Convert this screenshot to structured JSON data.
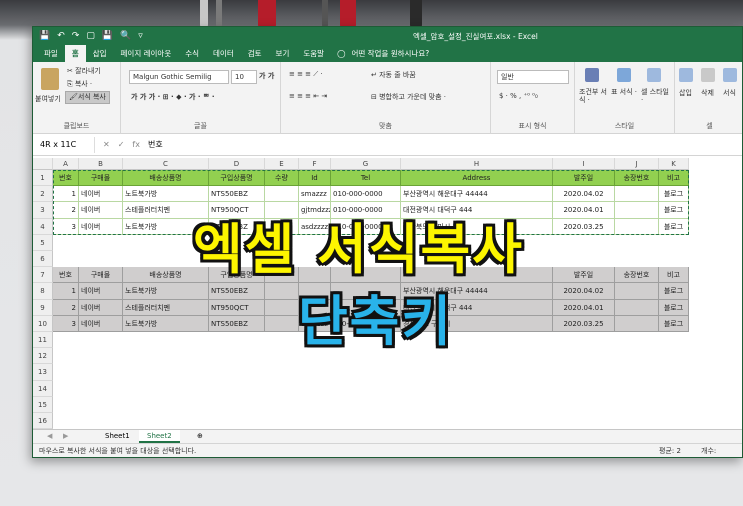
{
  "window": {
    "title": "엑셀_암호_설정_진실여포.xlsx  -  Excel",
    "quick_access": [
      "💾",
      "↶",
      "↷",
      "▢",
      "💾",
      "🔍",
      "▿"
    ]
  },
  "tabs": [
    "파일",
    "홈",
    "삽입",
    "페이지 레이아웃",
    "수식",
    "데이터",
    "검토",
    "보기",
    "도움말"
  ],
  "tell_me": "어떤 작업을 원하시나요?",
  "ribbon": {
    "clipboard": {
      "paste": "붙여넣기",
      "cut": "잘라내기",
      "copy": "복사 ·",
      "format_painter": "서식 복사",
      "label": "클립보드"
    },
    "font": {
      "name": "Malgun Gothic Semilig",
      "size": "10",
      "label": "글꼴"
    },
    "alignment": {
      "wrap": "자동 줄 바꿈",
      "merge": "병합하고 가운데 맞춤 ·",
      "label": "맞춤"
    },
    "number": {
      "format": "일반",
      "label": "표시 형식"
    },
    "styles": {
      "conditional": "조건부 서식 ·",
      "table": "표 서식 ·",
      "cell": "셀 스타일 ·",
      "label": "스타일"
    },
    "cells": {
      "insert": "삽입",
      "delete": "삭제",
      "format": "서식",
      "label": "셀"
    }
  },
  "formula_bar": {
    "name_box": "4R x 11C",
    "fx": "fx",
    "content": "번호"
  },
  "columns": [
    "A",
    "B",
    "C",
    "D",
    "E",
    "F",
    "G",
    "H",
    "I",
    "J",
    "K"
  ],
  "rows": [
    "1",
    "2",
    "3",
    "4",
    "5",
    "6",
    "7",
    "8",
    "9",
    "10",
    "11",
    "12",
    "13",
    "14",
    "15",
    "16"
  ],
  "table1": {
    "header": [
      "번호",
      "구매몰",
      "배송상품명",
      "구입상품명",
      "수량",
      "Id",
      "Tel",
      "Address",
      "발주일",
      "송장번호",
      "비고"
    ],
    "rows": [
      [
        "1",
        "네이버",
        "노트북가방",
        "NTS50EBZ",
        "",
        "smazzz",
        "010-000-0000",
        "부산광역시 해운대구 44444",
        "2020.04.02",
        "",
        "블로그"
      ],
      [
        "2",
        "네이버",
        "스테플러터치펜",
        "NT950QCT",
        "",
        "gjtmdzzz",
        "010-000-0000",
        "대전광역시 대덕구 444",
        "2020.04.01",
        "",
        "블로그"
      ],
      [
        "3",
        "네이버",
        "노트북가방",
        "NTS50EBZ",
        "",
        "asdzzzz",
        "010-000-0000",
        "경상북도 구미시",
        "2020.03.25",
        "",
        "블로그"
      ]
    ]
  },
  "table2": {
    "header": [
      "번호",
      "구매몰",
      "배송상품명",
      "구입상품명",
      "",
      "",
      "",
      "",
      "발주일",
      "송장번호",
      "비고"
    ],
    "rows": [
      [
        "1",
        "네이버",
        "노트북가방",
        "NTS50EBZ",
        "",
        "",
        "",
        "부산광역시 해운대구 44444",
        "2020.04.02",
        "",
        "블로그"
      ],
      [
        "2",
        "네이버",
        "스테플러터치펜",
        "NT950QCT",
        "",
        "",
        "",
        "대전광역시 대덕구 444",
        "2020.04.01",
        "",
        "블로그"
      ],
      [
        "3",
        "네이버",
        "노트북가방",
        "NTS50EBZ",
        "",
        "asdzzzz",
        "010-000-0000",
        "경상북도 구미시",
        "2020.03.25",
        "",
        "블로그"
      ]
    ]
  },
  "sheets": [
    "Sheet1",
    "Sheet2"
  ],
  "active_sheet": "Sheet2",
  "status": {
    "message": "마우스로 복사한 서식을 붙여 넣을 대상을 선택합니다.",
    "average": "평균: 2",
    "count": "개수:"
  },
  "overlay": {
    "line1": "엑셀 서식복사",
    "line2": "단축키"
  },
  "colors": {
    "excel_green": "#217346",
    "header_green": "#92d050",
    "gray_fill": "#d0cece",
    "overlay_yellow": "#fdf500",
    "overlay_blue": "#29b3ea"
  }
}
